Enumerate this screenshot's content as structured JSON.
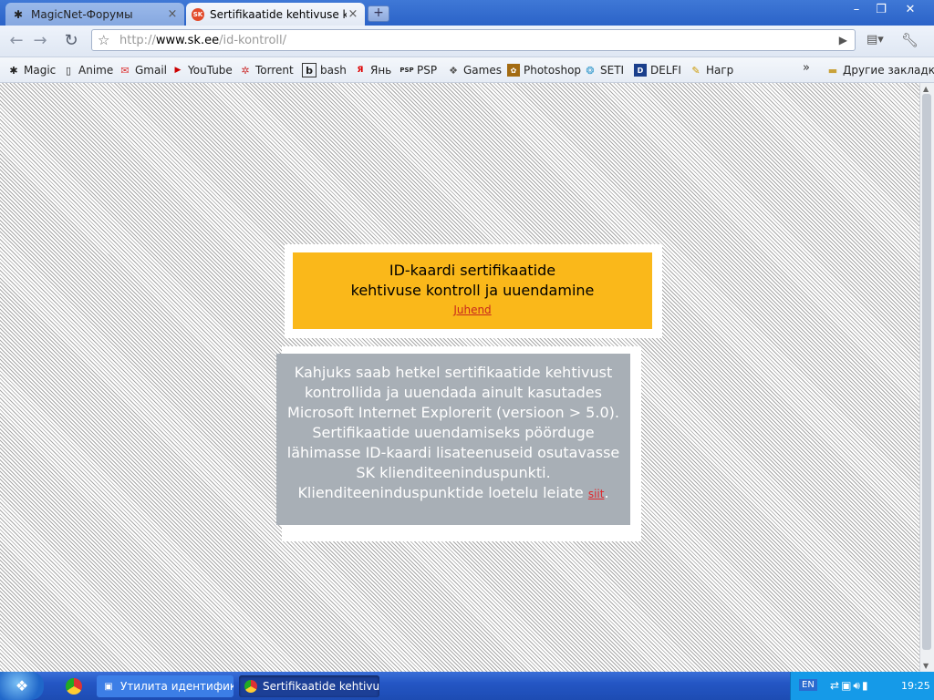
{
  "browser": {
    "tabs": [
      {
        "title": "MagicNet-Форумы",
        "active": false,
        "icon": "spider-icon"
      },
      {
        "title": "Sertifikaatide kehtivuse ko...",
        "active": true,
        "icon": "sk-favicon",
        "favicon_text": "SK"
      }
    ],
    "new_tab_symbol": "+",
    "url_scheme": "http://",
    "url_host": "www.sk.ee",
    "url_path": "/id-kontroll/",
    "bookmarks": [
      {
        "label": "Magic",
        "icon": "spider-icon"
      },
      {
        "label": "Anime",
        "icon": "page-icon"
      },
      {
        "label": "Gmail",
        "icon": "gmail-icon"
      },
      {
        "label": "YouTube",
        "icon": "youtube-icon"
      },
      {
        "label": "Torrent",
        "icon": "torrent-icon"
      },
      {
        "label": "bash",
        "icon": "bash-icon"
      },
      {
        "label": "Янь",
        "icon": "ya-icon"
      },
      {
        "label": "PSP",
        "icon": "psp-icon"
      },
      {
        "label": "Games",
        "icon": "games-icon"
      },
      {
        "label": "Photoshop",
        "icon": "photoshop-icon"
      },
      {
        "label": "SETI",
        "icon": "seti-icon"
      },
      {
        "label": "DELFI",
        "icon": "delfi-icon"
      },
      {
        "label": "Нагр",
        "icon": "pencil-icon"
      }
    ],
    "bookmarks_more": "»",
    "other_bookmarks": "Другие закладки"
  },
  "page": {
    "title_line_1": "ID-kaardi sertifikaatide",
    "title_line_2": "kehtivuse kontroll ja uuendamine",
    "guide_link": "Juhend",
    "message_lines": [
      "Kahjuks saab hetkel sertifikaatide kehtivust",
      "kontrollida ja uuendada ainult kasutades",
      "Microsoft Internet Explorerit (versioon > 5.0).",
      "Sertifikaatide uuendamiseks pöörduge",
      "lähimasse ID-kaardi lisateenuseid osutavasse",
      "SK klienditeeninduspunkti."
    ],
    "message_last_prefix": "Klienditeeninduspunktide loetelu leiate ",
    "message_last_link": "siit",
    "message_last_suffix": ".",
    "colors": {
      "title_box": "#fab81a",
      "message_box": "#a8afb6",
      "link": "#c8281e"
    }
  },
  "taskbar": {
    "tasks": [
      {
        "label": "Утилита идентифик...",
        "icon": "utility-icon"
      },
      {
        "label": "Sertifikaatide kehtivus...",
        "icon": "chrome-icon",
        "active": true
      }
    ],
    "language": "EN",
    "clock": "19:25"
  }
}
